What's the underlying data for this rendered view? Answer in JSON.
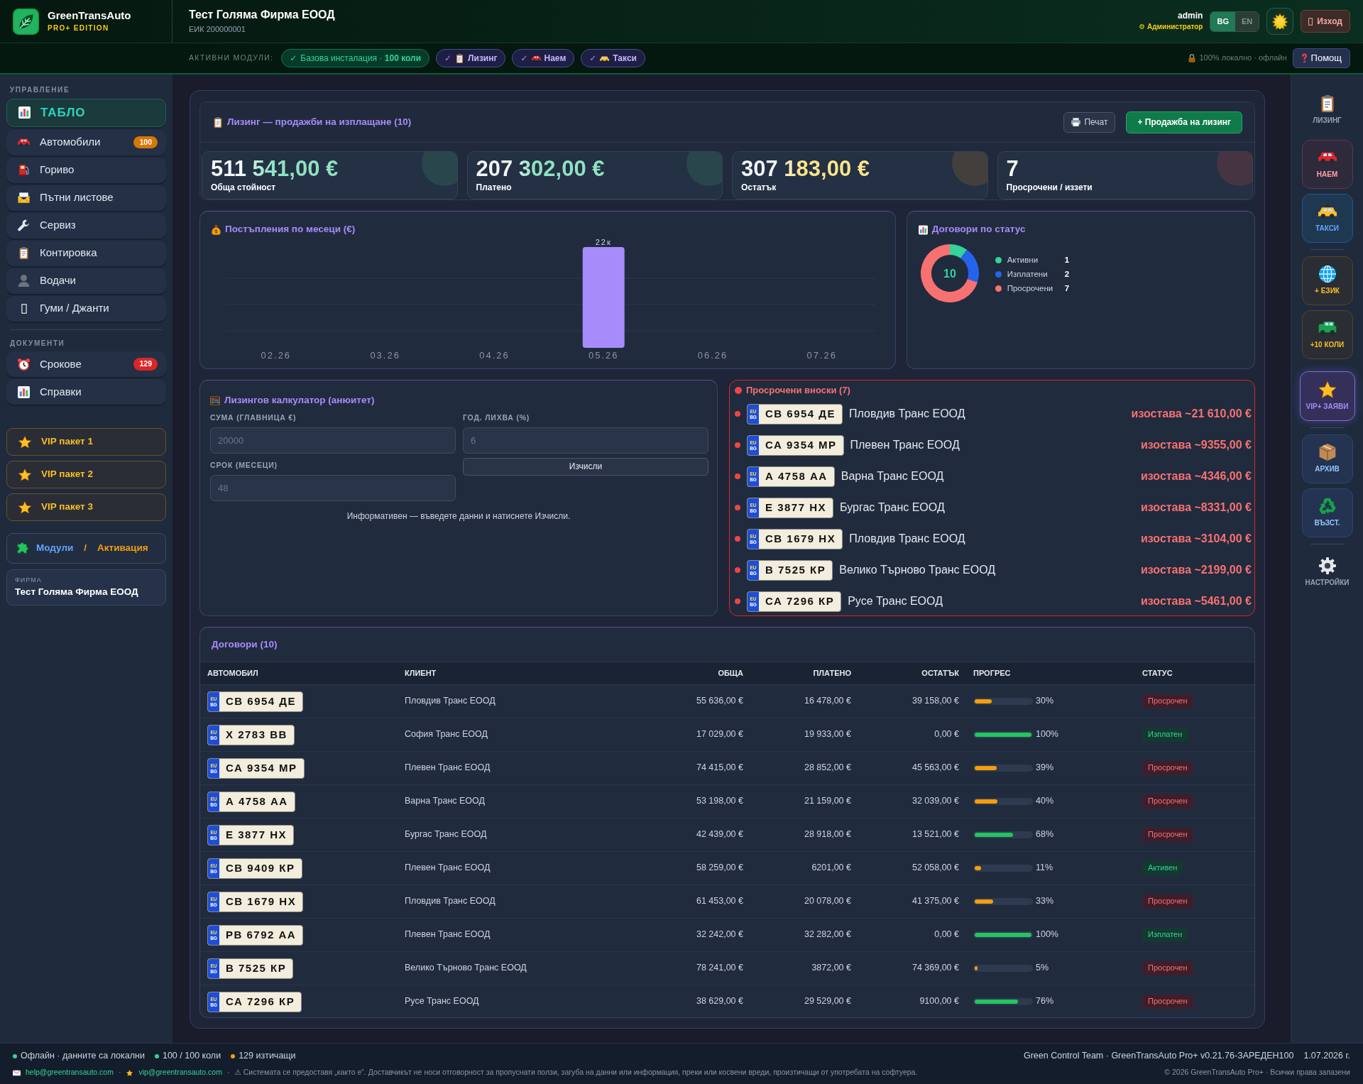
{
  "header": {
    "logo": {
      "title": "GreenTransAuto",
      "edition": "PRO+ EDITION"
    },
    "company": {
      "name": "Тест Голяма Фирма ЕООД",
      "eik": "ЕИК 200000001"
    },
    "user": {
      "name": "admin",
      "role": "⚙ Администратор"
    },
    "languages": [
      {
        "label": "BG",
        "selected": true
      },
      {
        "label": "EN",
        "selected": false
      }
    ],
    "logout_button": "Изход"
  },
  "modules_bar": {
    "label": "АКТИВНИ МОДУЛИ:",
    "modules": [
      {
        "kind": "base",
        "check": "✓",
        "label": "Базова инсталация · **100 коли**"
      },
      {
        "kind": "addon",
        "check": "✓",
        "label": "Лизинг"
      },
      {
        "kind": "addon",
        "check": "✓",
        "label": "Наем"
      },
      {
        "kind": "addon",
        "check": "✓",
        "label": "Такси"
      }
    ],
    "offline_note": "100% локално · офлайн",
    "help_button": "Помощ"
  },
  "sidebar": {
    "sections": [
      {
        "title": "УПРАВЛЕНИЕ",
        "items": [
          {
            "label": "ТАБЛО",
            "selected": true
          },
          {
            "label": "Автомобили",
            "selected": false,
            "badge": {
              "text": "100",
              "kind": "warning"
            }
          },
          {
            "label": "Гориво",
            "selected": false
          },
          {
            "label": "Пътни листове",
            "selected": false
          },
          {
            "label": "Сервиз",
            "selected": false
          },
          {
            "label": "Контировка",
            "selected": false
          },
          {
            "label": "Водачи",
            "selected": false
          },
          {
            "label": "Гуми / Джанти",
            "selected": false
          }
        ]
      },
      {
        "title": "ДОКУМЕНТИ",
        "items": [
          {
            "label": "Срокове",
            "selected": false,
            "badge": {
              "text": "129",
              "kind": "danger"
            }
          },
          {
            "label": "Справки",
            "selected": false
          }
        ]
      }
    ],
    "vip_packages": [
      "VIP пакет 1",
      "VIP пакет 2",
      "VIP пакет 3"
    ],
    "modules_link": {
      "first": "Модули",
      "separator": "/",
      "second": "Активация"
    },
    "firm": {
      "caption": "ФИРМА",
      "name": "Тест Голяма Фирма ЕООД"
    }
  },
  "leasing": {
    "title": "Лизинг — продажби на изплащане (10)",
    "print_button": "Печат",
    "add_button": "+ Продажба на лизинг",
    "stats": [
      {
        "value": "511 541,00 €",
        "label": "Обща стойност",
        "kind": "total"
      },
      {
        "value": "207 302,00 €",
        "label": "Платено",
        "kind": "paid"
      },
      {
        "value": "307 183,00 €",
        "label": "Остатък",
        "kind": "remaining"
      },
      {
        "value": "7",
        "label": "Просрочени / иззети",
        "kind": "overdue"
      }
    ]
  },
  "income_chart": {
    "chart_data": {
      "type": "bar",
      "title": "Постъпления по месеци (€)",
      "categories": [
        "02.26",
        "03.26",
        "04.26",
        "05.26",
        "06.26",
        "07.26"
      ],
      "values": [
        null,
        null,
        null,
        22,
        null,
        null
      ],
      "value_labels": [
        null,
        null,
        null,
        "22к",
        null,
        null
      ],
      "ylim": [
        0,
        22
      ]
    }
  },
  "status_chart": {
    "chart_data": {
      "type": "donut",
      "title": "Договори по статус",
      "categories": [
        "Активни",
        "Изплатени",
        "Просрочени"
      ],
      "values": [
        10,
        20,
        70
      ],
      "legend": "right"
    },
    "total": "10",
    "legend_items": [
      {
        "count": "1",
        "color": "#34d399"
      },
      {
        "count": "2",
        "color": "#2563eb"
      },
      {
        "count": "7",
        "color": "#f87171"
      }
    ]
  },
  "calculator": {
    "title": "Лизингов калкулатор (анюитет)",
    "fields": [
      {
        "label": "СУМА (ГЛАВНИЦА €)",
        "placeholder": "20000"
      },
      {
        "label": "ГОД. ЛИХВА (%)",
        "placeholder": "6"
      },
      {
        "label": "СРОК (МЕСЕЦИ)",
        "placeholder": "48"
      }
    ],
    "button": "Изчисли",
    "note": "Информативен — въведете данни и натиснете Изчисли."
  },
  "overdue": {
    "title": "Просрочени вноски (7)",
    "items": [
      {
        "plate": {
          "union": "EU",
          "country": "BG",
          "number": "СВ 6954 ДЕ"
        },
        "client": "Пловдив Транс ЕООД",
        "amount": "изостава ~21 610,00 €"
      },
      {
        "plate": {
          "union": "EU",
          "country": "BG",
          "number": "СА 9354 МР"
        },
        "client": "Плевен Транс ЕООД",
        "amount": "изостава ~9355,00 €"
      },
      {
        "plate": {
          "union": "EU",
          "country": "BG",
          "number": "А 4758 АА"
        },
        "client": "Варна Транс ЕООД",
        "amount": "изостава ~4346,00 €"
      },
      {
        "plate": {
          "union": "EU",
          "country": "BG",
          "number": "Е 3877 НХ"
        },
        "client": "Бургас Транс ЕООД",
        "amount": "изостава ~8331,00 €"
      },
      {
        "plate": {
          "union": "EU",
          "country": "BG",
          "number": "СВ 1679 НХ"
        },
        "client": "Пловдив Транс ЕООД",
        "amount": "изостава ~3104,00 €"
      },
      {
        "plate": {
          "union": "EU",
          "country": "BG",
          "number": "В 7525 КР"
        },
        "client": "Велико Търново Транс ЕООД",
        "amount": "изостава ~2199,00 €"
      },
      {
        "plate": {
          "union": "EU",
          "country": "BG",
          "number": "СА 7296 КР"
        },
        "client": "Русе Транс ЕООД",
        "amount": "изостава ~5461,00 €"
      }
    ]
  },
  "contracts": {
    "title": "Договори (10)",
    "columns": [
      "АВТОМОБИЛ",
      "КЛИЕНТ",
      "ОБЩА",
      "ПЛАТЕНО",
      "ОСТАТЪК",
      "ПРОГРЕС",
      "СТАТУС"
    ],
    "rows": [
      {
        "plate": {
          "union": "EU",
          "country": "BG",
          "number": "СВ 6954 ДЕ"
        },
        "client": "Пловдив Транс ЕООД",
        "total": "55 636,00 €",
        "paid": "16 478,00 €",
        "remaining": "39 158,00 €",
        "progress": {
          "level": 0.3,
          "text": "30%"
        },
        "status": {
          "label": "Просрочен",
          "kind": "overdue"
        }
      },
      {
        "plate": {
          "union": "EU",
          "country": "BG",
          "number": "Х 2783 ВВ"
        },
        "client": "София Транс ЕООД",
        "total": "17 029,00 €",
        "paid": "19 933,00 €",
        "remaining": "0,00 €",
        "progress": {
          "level": 1,
          "text": "100%"
        },
        "status": {
          "label": "Изплатен",
          "kind": "paid"
        }
      },
      {
        "plate": {
          "union": "EU",
          "country": "BG",
          "number": "СА 9354 МР"
        },
        "client": "Плевен Транс ЕООД",
        "total": "74 415,00 €",
        "paid": "28 852,00 €",
        "remaining": "45 563,00 €",
        "progress": {
          "level": 0.39,
          "text": "39%"
        },
        "status": {
          "label": "Просрочен",
          "kind": "overdue"
        }
      },
      {
        "plate": {
          "union": "EU",
          "country": "BG",
          "number": "А 4758 АА"
        },
        "client": "Варна Транс ЕООД",
        "total": "53 198,00 €",
        "paid": "21 159,00 €",
        "remaining": "32 039,00 €",
        "progress": {
          "level": 0.4,
          "text": "40%"
        },
        "status": {
          "label": "Просрочен",
          "kind": "overdue"
        }
      },
      {
        "plate": {
          "union": "EU",
          "country": "BG",
          "number": "Е 3877 НХ"
        },
        "client": "Бургас Транс ЕООД",
        "total": "42 439,00 €",
        "paid": "28 918,00 €",
        "remaining": "13 521,00 €",
        "progress": {
          "level": 0.68,
          "text": "68%"
        },
        "status": {
          "label": "Просрочен",
          "kind": "overdue"
        }
      },
      {
        "plate": {
          "union": "EU",
          "country": "BG",
          "number": "СВ 9409 КР"
        },
        "client": "Плевен Транс ЕООД",
        "total": "58 259,00 €",
        "paid": "6201,00 €",
        "remaining": "52 058,00 €",
        "progress": {
          "level": 0.11,
          "text": "11%"
        },
        "status": {
          "label": "Активен",
          "kind": "active"
        }
      },
      {
        "plate": {
          "union": "EU",
          "country": "BG",
          "number": "СВ 1679 НХ"
        },
        "client": "Пловдив Транс ЕООД",
        "total": "61 453,00 €",
        "paid": "20 078,00 €",
        "remaining": "41 375,00 €",
        "progress": {
          "level": 0.33,
          "text": "33%"
        },
        "status": {
          "label": "Просрочен",
          "kind": "overdue"
        }
      },
      {
        "plate": {
          "union": "EU",
          "country": "BG",
          "number": "РВ 6792 АА"
        },
        "client": "Плевен Транс ЕООД",
        "total": "32 242,00 €",
        "paid": "32 282,00 €",
        "remaining": "0,00 €",
        "progress": {
          "level": 1,
          "text": "100%"
        },
        "status": {
          "label": "Изплатен",
          "kind": "paid"
        }
      },
      {
        "plate": {
          "union": "EU",
          "country": "BG",
          "number": "В 7525 КР"
        },
        "client": "Велико Търново Транс ЕООД",
        "total": "78 241,00 €",
        "paid": "3872,00 €",
        "remaining": "74 369,00 €",
        "progress": {
          "level": 0.05,
          "text": "5%"
        },
        "status": {
          "label": "Просрочен",
          "kind": "overdue"
        }
      },
      {
        "plate": {
          "union": "EU",
          "country": "BG",
          "number": "СА 7296 КР"
        },
        "client": "Русе Транс ЕООД",
        "total": "38 629,00 €",
        "paid": "29 529,00 €",
        "remaining": "9100,00 €",
        "progress": {
          "level": 0.76,
          "text": "76%"
        },
        "status": {
          "label": "Просрочен",
          "kind": "overdue"
        }
      }
    ]
  },
  "right_rail": {
    "groups": [
      {
        "items": [
          {
            "label": "ЛИЗИНГ",
            "kind": "plain"
          },
          {
            "label": "НАЕМ",
            "kind": "rent"
          },
          {
            "label": "ТАКСИ",
            "kind": "taxi"
          }
        ]
      },
      {
        "items": [
          {
            "label": "+ ЕЗИК",
            "kind": "addon"
          },
          {
            "label": "+10 КОЛИ",
            "kind": "addon"
          },
          {
            "label": "VIP+ ЗАЯВИ",
            "kind": "vip"
          }
        ]
      },
      {
        "items": [
          {
            "label": "АРХИВ",
            "kind": "archive"
          },
          {
            "label": "ВЪЗСТ.",
            "kind": "archive"
          }
        ]
      },
      {
        "items": [
          {
            "label": "НАСТРОЙКИ",
            "kind": "plain"
          }
        ]
      }
    ]
  },
  "footer": {
    "status": [
      {
        "text": "Офлайн · данните са локални",
        "color": "#34d399"
      },
      {
        "text": "100 / 100 коли",
        "color": "#34d399"
      },
      {
        "text": "129 изтичащи",
        "color": "#f59e0b"
      }
    ],
    "version": "Green Control Team · GreenTransAuto Pro+ v0.21.76-ЗАРЕДЕН100",
    "date": "1.07.2026 г.",
    "contacts": [
      {
        "email": "help@greentransauto.com",
        "separator": "·"
      },
      {
        "email": "vip@greentransauto.com",
        "separator": "·"
      }
    ],
    "disclaimer": "⚠ Системата се предоставя „както е“. Доставчикът не носи отговорност за пропуснати ползи, загуба на данни или информация, преки или косвени вреди, произтичащи от употребата на софтуера.",
    "copyright": "© 2026 GreenTransAuto Pro+ · Всички права запазени"
  }
}
